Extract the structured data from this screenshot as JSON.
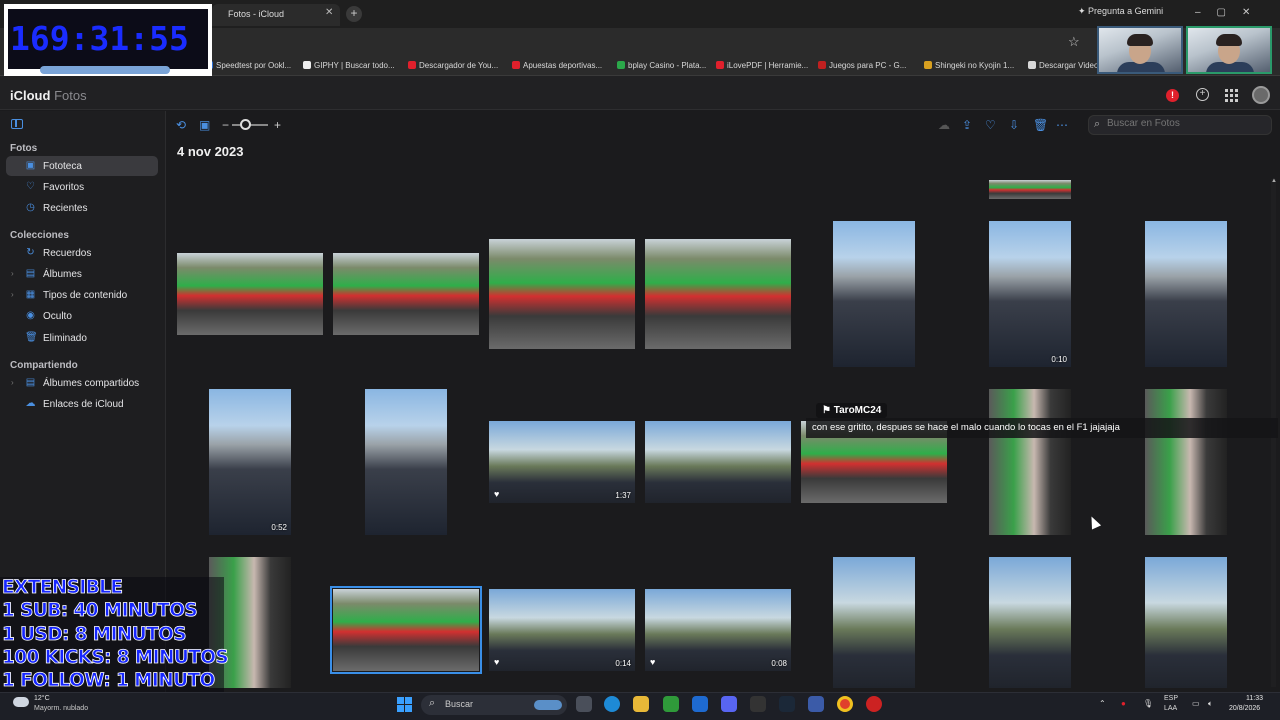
{
  "browser": {
    "active_tab": "Fotos - iCloud",
    "gemini_button": "Pregunta a Gemini",
    "bookmarks": [
      {
        "label": "Speedtest por Ookl...",
        "color": "#2b6fd6"
      },
      {
        "label": "GIPHY | Buscar todo...",
        "color": "#eeeeee"
      },
      {
        "label": "Descargador de You...",
        "color": "#e0202c"
      },
      {
        "label": "Apuestas deportivas...",
        "color": "#e0202c"
      },
      {
        "label": "bplay Casino - Plata...",
        "color": "#2ba84a"
      },
      {
        "label": "iLovePDF | Herramie...",
        "color": "#e0202c"
      },
      {
        "label": "Juegos para PC - G...",
        "color": "#c02020"
      },
      {
        "label": "Shingeki no Kyojin 1...",
        "color": "#d8a020"
      },
      {
        "label": "Descargar Videos",
        "color": "#d8d8d8"
      }
    ]
  },
  "overlay": {
    "timer": "169:31:55",
    "extensible": [
      "EXTENSIBLE",
      "1 SUB: 40 MINUTOS",
      "1 USD: 8 MINUTOS",
      "100 KICKS: 8 MINUTOS",
      "1 FOLLOW: 1 MINUTO"
    ],
    "chat_user": "TaroMC24",
    "chat_message": "con ese gritito, despues se hace el malo cuando lo tocas en el F1 jajajaja"
  },
  "app": {
    "brand": "iCloud",
    "section": "Fotos",
    "alert_badge": "!",
    "accent": "#4a8fe0"
  },
  "sidebar": {
    "groups": [
      {
        "title": "Fotos",
        "items": [
          "Fototeca",
          "Favoritos",
          "Recientes"
        ]
      },
      {
        "title": "Colecciones",
        "items": [
          "Recuerdos",
          "Álbumes",
          "Tipos de contenido",
          "Oculto",
          "Eliminado"
        ]
      },
      {
        "title": "Compartiendo",
        "items": [
          "Álbumes compartidos",
          "Enlaces de iCloud"
        ]
      }
    ],
    "active_item": "Fototeca"
  },
  "toolbar": {
    "search_placeholder": "Buscar en Fotos",
    "zoom_minus": "−",
    "zoom_plus": "+"
  },
  "library": {
    "date": "4 nov 2023",
    "durations": {
      "r1c6": "0:10",
      "r2c1": "0:52",
      "r2c3": "1:37",
      "r3c3": "0:14",
      "r3c4": "0:08"
    }
  },
  "taskbar": {
    "weather_temp": "12°C",
    "weather_desc": "Mayorm. nublado",
    "search_label": "Buscar",
    "lang": "ESP",
    "lang2": "LAA",
    "time": "11:33",
    "date": "20/8/2026"
  }
}
